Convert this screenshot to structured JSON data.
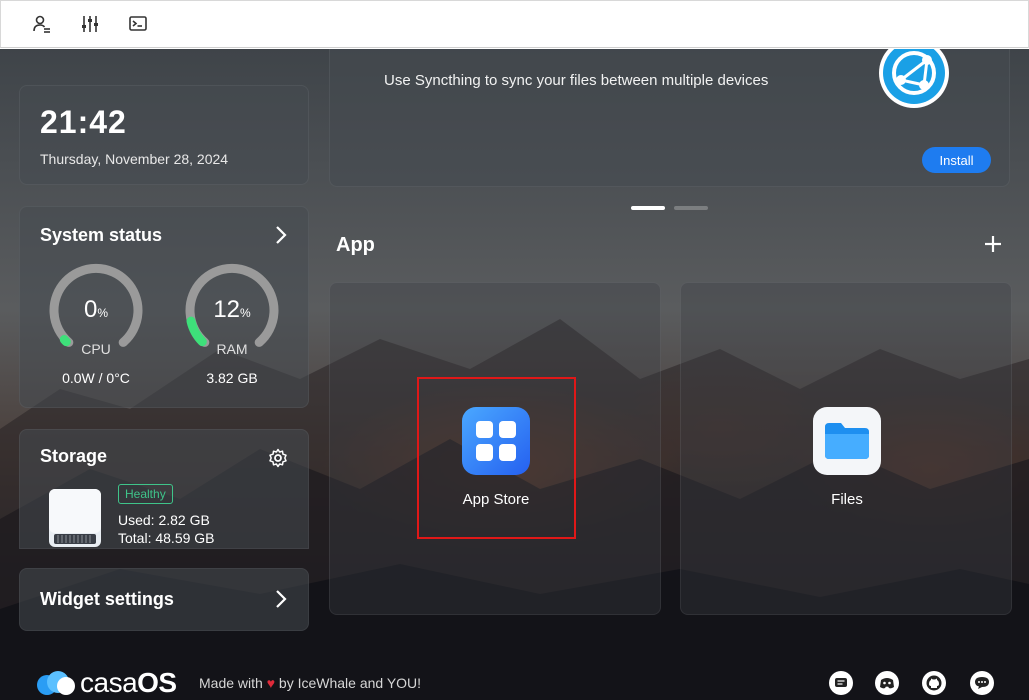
{
  "toolbar": {
    "icons": [
      "user-icon",
      "sliders-icon",
      "terminal-icon"
    ]
  },
  "clock": {
    "time": "21:42",
    "date": "Thursday, November 28, 2024"
  },
  "system_status": {
    "title": "System status",
    "cpu": {
      "value": "0",
      "unit": "%",
      "label": "CPU",
      "detail": "0.0W / 0°C",
      "percent": 0
    },
    "ram": {
      "value": "12",
      "unit": "%",
      "label": "RAM",
      "detail": "3.82 GB",
      "percent": 12
    }
  },
  "storage": {
    "title": "Storage",
    "health": "Healthy",
    "used": "Used: 2.82 GB",
    "total": "Total: 48.59 GB"
  },
  "widget_settings": {
    "title": "Widget settings"
  },
  "banner": {
    "text": "Use Syncthing to sync your files between multiple devices",
    "install_label": "Install",
    "active_slide": 1,
    "slide_count": 2
  },
  "apps": {
    "heading": "App",
    "items": [
      {
        "label": "App Store",
        "icon": "app-store-icon"
      },
      {
        "label": "Files",
        "icon": "folder-icon"
      }
    ]
  },
  "footer": {
    "brand_first": "casa",
    "brand_second": "OS",
    "made_with_prefix": "Made with",
    "made_with_suffix": "by IceWhale and YOU!",
    "social_icons": [
      "chat-icon",
      "discord-icon",
      "github-icon",
      "message-icon"
    ]
  },
  "colors": {
    "accent": "#1e7cf0",
    "gauge_green": "#3ee07a",
    "healthy": "#3fc48a",
    "highlight": "#e01818"
  }
}
